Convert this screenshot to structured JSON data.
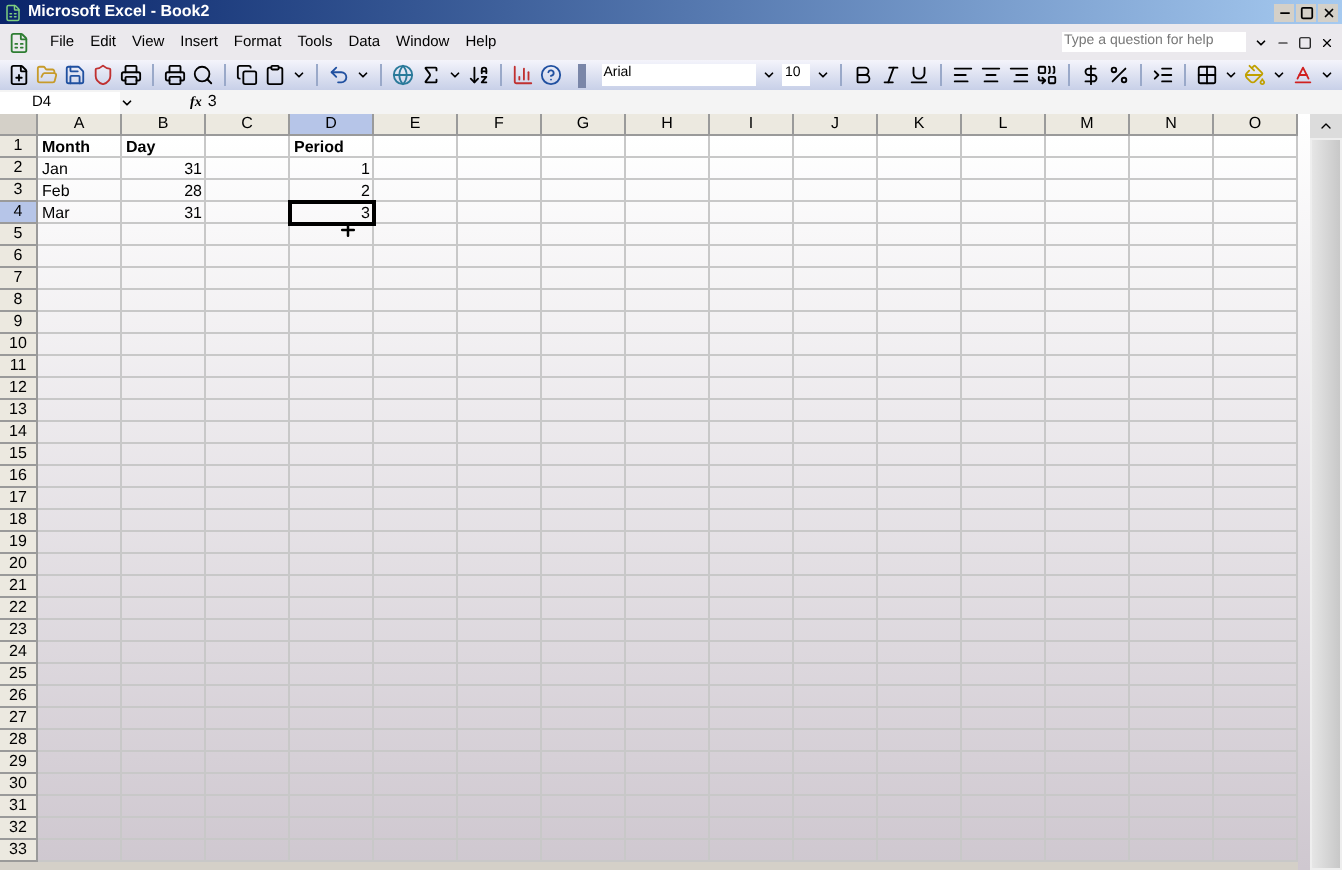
{
  "window": {
    "title": "Microsoft Excel - Book2"
  },
  "menu": [
    {
      "label": "File"
    },
    {
      "label": "Edit"
    },
    {
      "label": "View"
    },
    {
      "label": "Insert"
    },
    {
      "label": "Format"
    },
    {
      "label": "Tools"
    },
    {
      "label": "Data"
    },
    {
      "label": "Window"
    },
    {
      "label": "Help"
    }
  ],
  "help_box": {
    "placeholder": "Type a question for help"
  },
  "font": {
    "name": "Arial",
    "size": "10"
  },
  "formula_bar": {
    "name_box": "D4",
    "fx": "fx",
    "value": "3"
  },
  "columns": [
    {
      "label": "A",
      "selected": false
    },
    {
      "label": "B",
      "selected": false
    },
    {
      "label": "C",
      "selected": false
    },
    {
      "label": "D",
      "selected": true
    },
    {
      "label": "E",
      "selected": false
    },
    {
      "label": "F",
      "selected": false
    },
    {
      "label": "G",
      "selected": false
    },
    {
      "label": "H",
      "selected": false
    },
    {
      "label": "I",
      "selected": false
    },
    {
      "label": "J",
      "selected": false
    },
    {
      "label": "K",
      "selected": false
    },
    {
      "label": "L",
      "selected": false
    },
    {
      "label": "M",
      "selected": false
    },
    {
      "label": "N",
      "selected": false
    },
    {
      "label": "O",
      "selected": false
    }
  ],
  "rows": [
    {
      "number": "1",
      "selected": false,
      "bold": true,
      "cells": {
        "A": {
          "text": "Month",
          "right_aligned": false,
          "selected": false
        },
        "B": {
          "text": "Day",
          "right_aligned": false,
          "selected": false
        },
        "D": {
          "text": "Period",
          "right_aligned": false,
          "selected": false
        }
      }
    },
    {
      "number": "2",
      "selected": false,
      "bold": false,
      "cells": {
        "A": {
          "text": "Jan",
          "right_aligned": false,
          "selected": false
        },
        "B": {
          "text": "31",
          "right_aligned": true,
          "selected": false
        },
        "D": {
          "text": "1",
          "right_aligned": true,
          "selected": false
        }
      }
    },
    {
      "number": "3",
      "selected": false,
      "bold": false,
      "cells": {
        "A": {
          "text": "Feb",
          "right_aligned": false,
          "selected": false
        },
        "B": {
          "text": "28",
          "right_aligned": true,
          "selected": false
        },
        "D": {
          "text": "2",
          "right_aligned": true,
          "selected": false
        }
      }
    },
    {
      "number": "4",
      "selected": true,
      "bold": false,
      "cells": {
        "A": {
          "text": "Mar",
          "right_aligned": false,
          "selected": false
        },
        "B": {
          "text": "31",
          "right_aligned": true,
          "selected": false
        },
        "D": {
          "text": "3",
          "right_aligned": true,
          "selected": true
        }
      }
    },
    {
      "number": "5",
      "selected": false
    },
    {
      "number": "6",
      "selected": false
    },
    {
      "number": "7",
      "selected": false
    },
    {
      "number": "8",
      "selected": false
    },
    {
      "number": "9",
      "selected": false
    },
    {
      "number": "10",
      "selected": false
    },
    {
      "number": "11",
      "selected": false
    },
    {
      "number": "12",
      "selected": false
    },
    {
      "number": "13",
      "selected": false
    },
    {
      "number": "14",
      "selected": false
    },
    {
      "number": "15",
      "selected": false
    },
    {
      "number": "16",
      "selected": false
    },
    {
      "number": "17",
      "selected": false
    },
    {
      "number": "18",
      "selected": false
    },
    {
      "number": "19",
      "selected": false
    },
    {
      "number": "20",
      "selected": false
    },
    {
      "number": "21",
      "selected": false
    },
    {
      "number": "22",
      "selected": false
    },
    {
      "number": "23",
      "selected": false
    },
    {
      "number": "24",
      "selected": false
    },
    {
      "number": "25",
      "selected": false
    },
    {
      "number": "26",
      "selected": false
    },
    {
      "number": "27",
      "selected": false
    },
    {
      "number": "28",
      "selected": false
    },
    {
      "number": "29",
      "selected": false
    },
    {
      "number": "30",
      "selected": false
    },
    {
      "number": "31",
      "selected": false
    },
    {
      "number": "32",
      "selected": false
    },
    {
      "number": "33",
      "selected": false
    }
  ]
}
